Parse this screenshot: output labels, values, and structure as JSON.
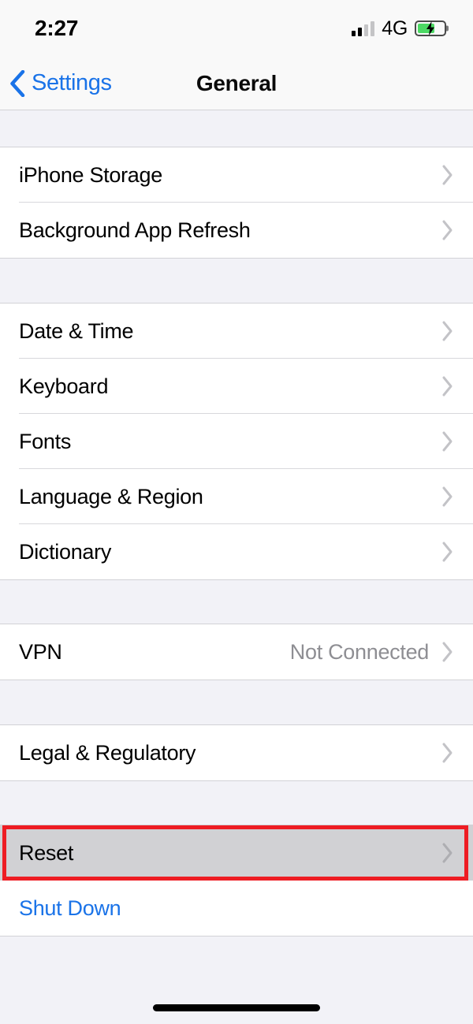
{
  "status_bar": {
    "time": "2:27",
    "network": "4G",
    "signal_bars_total": 4,
    "signal_bars_filled": 2,
    "battery_percent": 66,
    "battery_charging": true,
    "battery_color": "#4cd964"
  },
  "nav": {
    "back_label": "Settings",
    "title": "General",
    "accent_color": "#1a73e8"
  },
  "sections": [
    {
      "rows": [
        {
          "label": "iPhone Storage",
          "value": "",
          "chevron": true,
          "style": "default"
        },
        {
          "label": "Background App Refresh",
          "value": "",
          "chevron": true,
          "style": "default"
        }
      ]
    },
    {
      "rows": [
        {
          "label": "Date & Time",
          "value": "",
          "chevron": true,
          "style": "default"
        },
        {
          "label": "Keyboard",
          "value": "",
          "chevron": true,
          "style": "default"
        },
        {
          "label": "Fonts",
          "value": "",
          "chevron": true,
          "style": "default"
        },
        {
          "label": "Language & Region",
          "value": "",
          "chevron": true,
          "style": "default"
        },
        {
          "label": "Dictionary",
          "value": "",
          "chevron": true,
          "style": "default"
        }
      ]
    },
    {
      "rows": [
        {
          "label": "VPN",
          "value": "Not Connected",
          "chevron": true,
          "style": "default"
        }
      ]
    },
    {
      "rows": [
        {
          "label": "Legal & Regulatory",
          "value": "",
          "chevron": true,
          "style": "default"
        }
      ]
    },
    {
      "rows": [
        {
          "label": "Reset",
          "value": "",
          "chevron": true,
          "style": "pressed"
        },
        {
          "label": "Shut Down",
          "value": "",
          "chevron": false,
          "style": "link"
        }
      ]
    }
  ],
  "annotation": {
    "target_row_label": "Reset",
    "box_color": "#ee1c23",
    "box_border_width_px": 5
  },
  "home_indicator": {
    "visible": true,
    "color": "#000000"
  }
}
